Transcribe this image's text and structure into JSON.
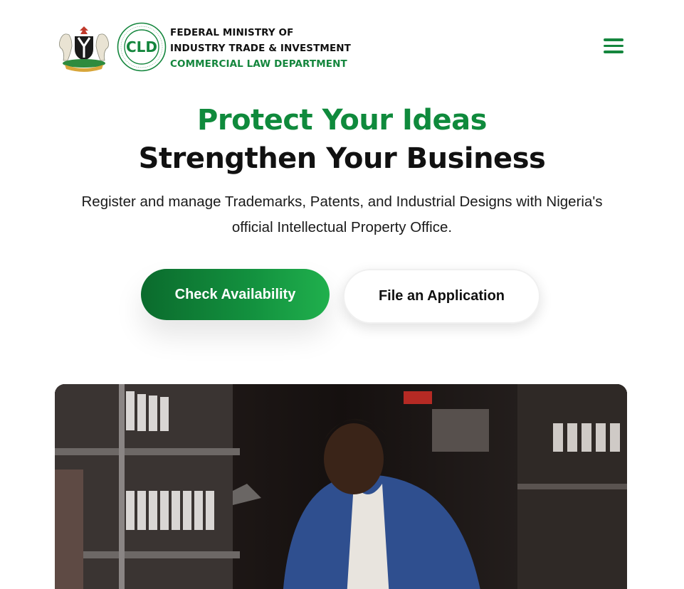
{
  "header": {
    "brand_line1": "FEDERAL MINISTRY OF",
    "brand_line2": "INDUSTRY TRADE & INVESTMENT",
    "brand_line3": "COMMERCIAL LAW DEPARTMENT",
    "seal_text": "CLD",
    "coat_icon": "nigeria-coat-of-arms",
    "menu_icon": "hamburger-menu-icon"
  },
  "hero": {
    "title_line1": "Protect Your Ideas",
    "title_line2": "Strengthen Your Business",
    "subtitle": "Register and manage Trademarks, Patents, and Industrial Designs with Nigeria's official Intellectual Property Office.",
    "primary_button": "Check Availability",
    "secondary_button": "File an Application"
  },
  "colors": {
    "brand_green": "#0f8a3c",
    "dark_text": "#111111",
    "background": "#ffffff"
  }
}
